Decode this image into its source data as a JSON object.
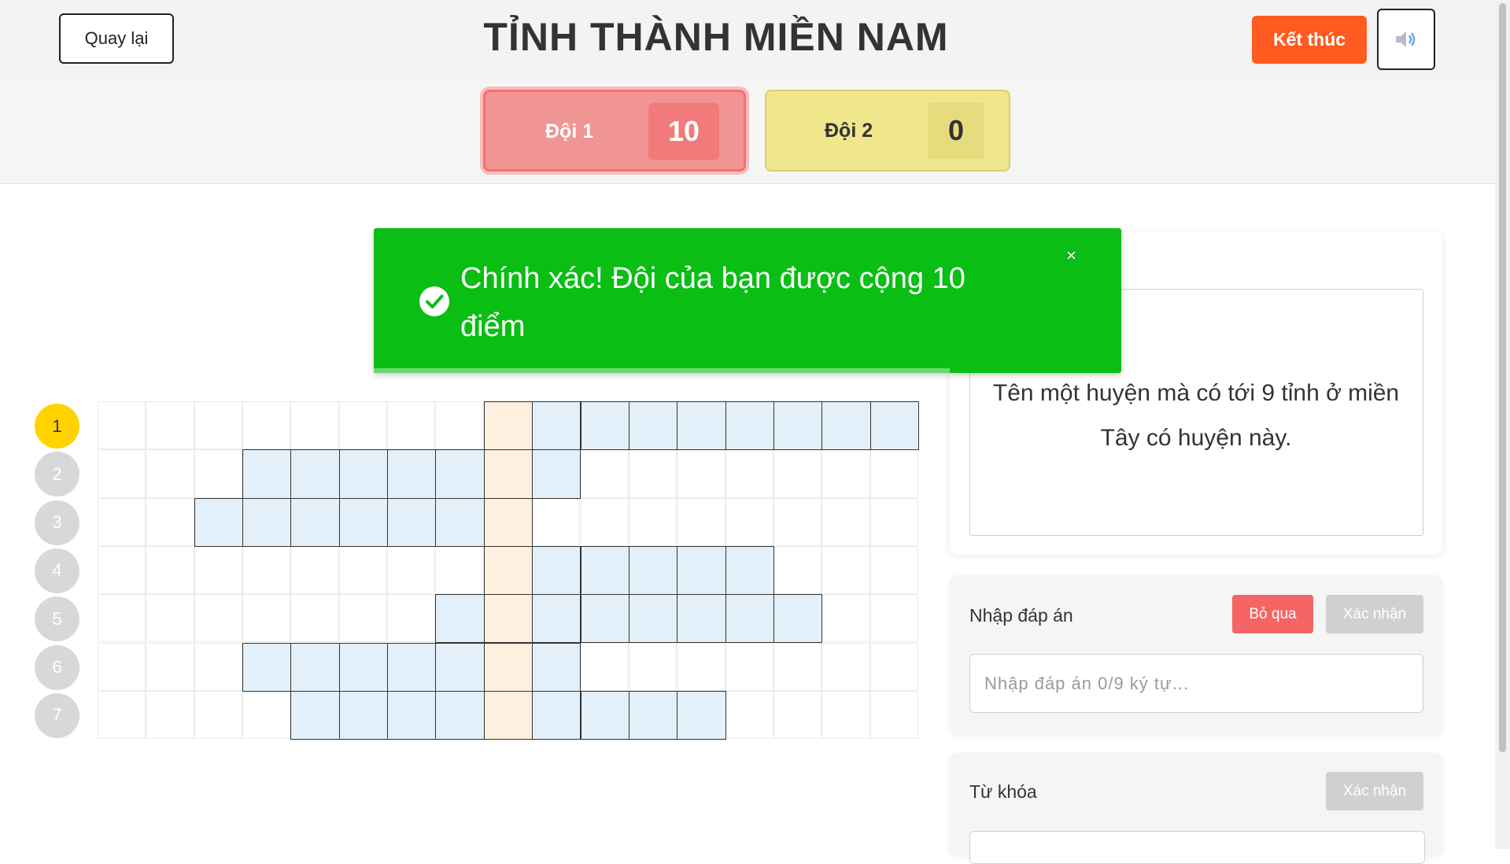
{
  "header": {
    "back_label": "Quay lại",
    "title": "TỈNH THÀNH MIỀN NAM",
    "end_label": "Kết thúc",
    "sound_icon": "speaker-icon"
  },
  "teams": [
    {
      "name": "Đội 1",
      "score": "10",
      "active": true,
      "color": "#f09494"
    },
    {
      "name": "Đội 2",
      "score": "0",
      "active": false,
      "color": "#f0e68c"
    }
  ],
  "toast": {
    "message": "Chính xác! Đội của bạn được cộng 10 điểm",
    "icon": "check-circle-icon",
    "close": "×",
    "color": "#0abe14",
    "progress_remaining": 0.77
  },
  "puzzle": {
    "grid_columns": 17,
    "grid_rows": 7,
    "key_column": 8,
    "rows": [
      {
        "number": "1",
        "start": 8,
        "length": 9,
        "active": true
      },
      {
        "number": "2",
        "start": 3,
        "length": 7,
        "active": false
      },
      {
        "number": "3",
        "start": 2,
        "length": 7,
        "active": false
      },
      {
        "number": "4",
        "start": 8,
        "length": 6,
        "active": false
      },
      {
        "number": "5",
        "start": 7,
        "length": 8,
        "active": false
      },
      {
        "number": "6",
        "start": 3,
        "length": 7,
        "active": false
      },
      {
        "number": "7",
        "start": 4,
        "length": 9,
        "active": false
      }
    ],
    "colors": {
      "letter_cell": "#e3f0fa",
      "key_cell": "#fdf0de",
      "active_number": "#ffd200"
    }
  },
  "question": {
    "text": "Tên một huyện mà có tới 9 tỉnh ở miền Tây có huyện này."
  },
  "answer": {
    "label": "Nhập đáp án",
    "skip_label": "Bỏ qua",
    "confirm_label": "Xác nhận",
    "placeholder": "Nhập đáp án 0/9 ký tự...",
    "value": ""
  },
  "keyword": {
    "label": "Từ khóa",
    "confirm_label": "Xác nhận"
  }
}
